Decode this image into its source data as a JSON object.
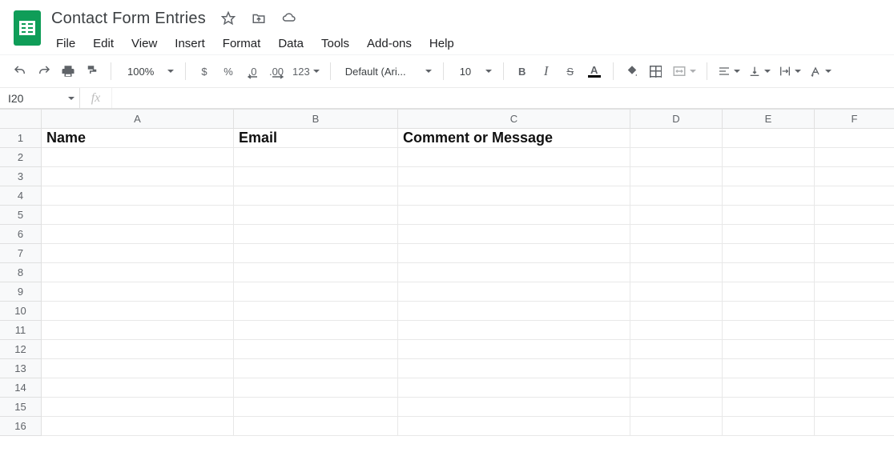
{
  "document": {
    "title": "Contact Form Entries"
  },
  "menus": {
    "file": "File",
    "edit": "Edit",
    "view": "View",
    "insert": "Insert",
    "format": "Format",
    "data": "Data",
    "tools": "Tools",
    "addons": "Add-ons",
    "help": "Help"
  },
  "toolbar": {
    "zoom": "100%",
    "currency": "$",
    "percent": "%",
    "dec_dec": ".0",
    "dec_inc": ".00",
    "num_fmt": "123",
    "font": "Default (Ari...",
    "font_size": "10"
  },
  "name_box": "I20",
  "fx_symbol": "fx",
  "columns": [
    "A",
    "B",
    "C",
    "D",
    "E",
    "F"
  ],
  "rows": [
    "1",
    "2",
    "3",
    "4",
    "5",
    "6",
    "7",
    "8",
    "9",
    "10",
    "11",
    "12",
    "13",
    "14",
    "15",
    "16"
  ],
  "headers": {
    "A1": "Name",
    "B1": "Email",
    "C1": "Comment or Message"
  }
}
